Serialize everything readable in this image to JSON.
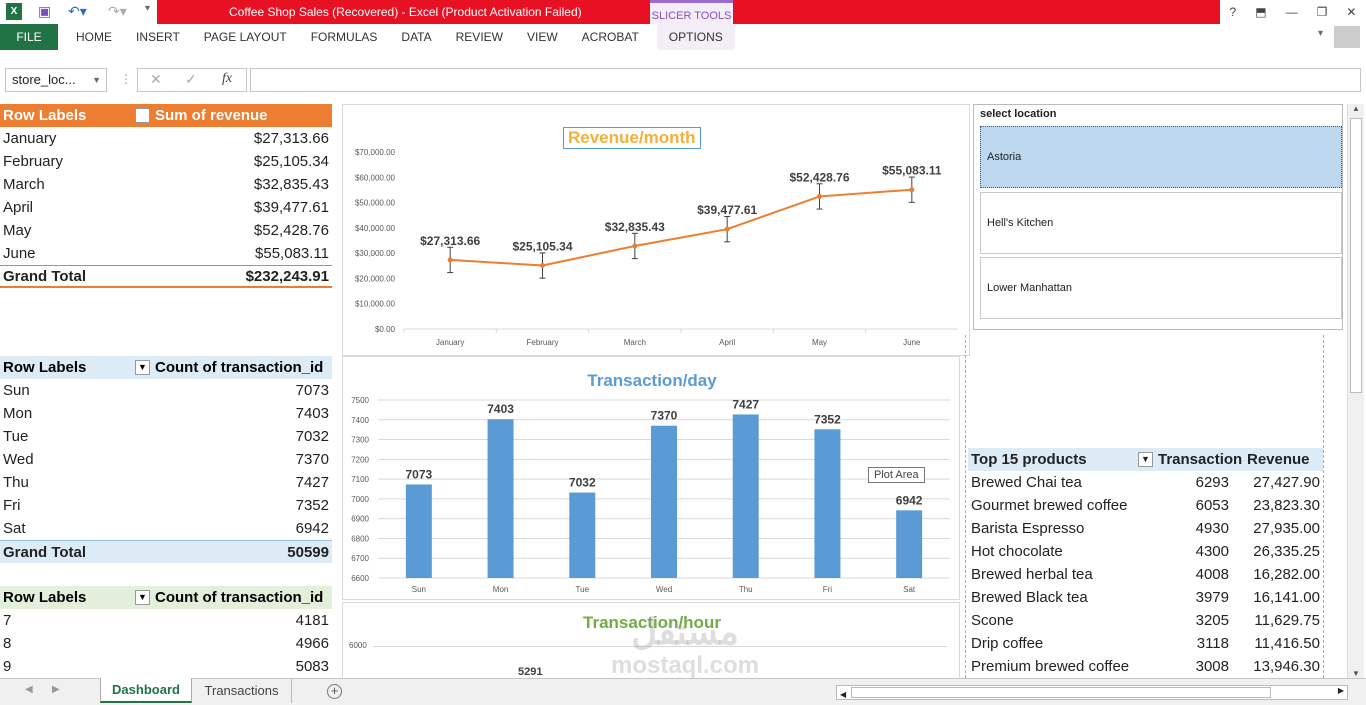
{
  "window": {
    "title": "Coffee Shop Sales (Recovered) -  Excel (Product Activation Failed)",
    "context_tab": "SLICER TOOLS",
    "help": "?"
  },
  "ribbon": {
    "tabs": [
      "FILE",
      "HOME",
      "INSERT",
      "PAGE LAYOUT",
      "FORMULAS",
      "DATA",
      "REVIEW",
      "VIEW",
      "ACROBAT",
      "OPTIONS"
    ]
  },
  "formula_bar": {
    "name_box": "store_loc...",
    "fx": "fx",
    "value": ""
  },
  "revenue_table": {
    "headers": [
      "Row Labels",
      "Sum of revenue"
    ],
    "rows": [
      [
        "January",
        "$27,313.66"
      ],
      [
        "February",
        "$25,105.34"
      ],
      [
        "March",
        "$32,835.43"
      ],
      [
        "April",
        "$39,477.61"
      ],
      [
        "May",
        "$52,428.76"
      ],
      [
        "June",
        "$55,083.11"
      ]
    ],
    "total": [
      "Grand Total",
      "$232,243.91"
    ]
  },
  "day_table": {
    "headers": [
      "Row Labels",
      "Count of transaction_id"
    ],
    "rows": [
      [
        "Sun",
        "7073"
      ],
      [
        "Mon",
        "7403"
      ],
      [
        "Tue",
        "7032"
      ],
      [
        "Wed",
        "7370"
      ],
      [
        "Thu",
        "7427"
      ],
      [
        "Fri",
        "7352"
      ],
      [
        "Sat",
        "6942"
      ]
    ],
    "total": [
      "Grand Total",
      "50599"
    ]
  },
  "hour_table": {
    "headers": [
      "Row Labels",
      "Count of transaction_id"
    ],
    "rows": [
      [
        "7",
        "4181"
      ],
      [
        "8",
        "4966"
      ],
      [
        "9",
        "5083"
      ]
    ]
  },
  "slicer": {
    "title": "select location",
    "items": [
      "Astoria",
      "Hell's Kitchen",
      "Lower Manhattan"
    ],
    "selected": "Astoria"
  },
  "products_table": {
    "headers": [
      "Top 15 products",
      "Transaction",
      "Revenue"
    ],
    "rows": [
      [
        "Brewed Chai tea",
        "6293",
        "27,427.90"
      ],
      [
        "Gourmet brewed coffee",
        "6053",
        "23,823.30"
      ],
      [
        "Barista Espresso",
        "4930",
        "27,935.00"
      ],
      [
        "Hot chocolate",
        "4300",
        "26,335.25"
      ],
      [
        "Brewed herbal tea",
        "4008",
        "16,282.00"
      ],
      [
        "Brewed Black tea",
        "3979",
        "16,141.00"
      ],
      [
        "Scone",
        "3205",
        "11,629.75"
      ],
      [
        "Drip coffee",
        "3118",
        "11,416.50"
      ],
      [
        "Premium brewed coffee",
        "3008",
        "13,946.30"
      ]
    ]
  },
  "tooltip": "Plot Area",
  "sheets": {
    "tabs": [
      "Dashboard",
      "Transactions"
    ],
    "active": "Dashboard"
  },
  "watermark": {
    "arabic": "مستقل",
    "latin": "mostaql.com"
  },
  "chart_data": [
    {
      "type": "line",
      "title": "Revenue/month",
      "categories": [
        "January",
        "February",
        "March",
        "April",
        "May",
        "June"
      ],
      "values": [
        27313.66,
        25105.34,
        32835.43,
        39477.61,
        52428.76,
        55083.11
      ],
      "labels": [
        "$27,313.66",
        "$25,105.34",
        "$32,835.43",
        "$39,477.61",
        "$52,428.76",
        "$55,083.11"
      ],
      "yticks": [
        "$0.00",
        "$10,000.00",
        "$20,000.00",
        "$30,000.00",
        "$40,000.00",
        "$50,000.00",
        "$60,000.00",
        "$70,000.00"
      ],
      "ylim": [
        0,
        70000
      ],
      "error_bars": 5000,
      "color": "#ED7D31",
      "title_color": "#F4B03A"
    },
    {
      "type": "bar",
      "title": "Transaction/day",
      "categories": [
        "Sun",
        "Mon",
        "Tue",
        "Wed",
        "Thu",
        "Fri",
        "Sat"
      ],
      "values": [
        7073,
        7403,
        7032,
        7370,
        7427,
        7352,
        6942
      ],
      "yticks": [
        "6600",
        "6700",
        "6800",
        "6900",
        "7000",
        "7100",
        "7200",
        "7300",
        "7400",
        "7500"
      ],
      "ylim": [
        6600,
        7500
      ],
      "color": "#5B9BD5",
      "title_color": "#5B9BD5"
    },
    {
      "type": "bar",
      "title": "Transaction/hour",
      "yticks": [
        "6000"
      ],
      "visible_labels": [
        "5291"
      ],
      "title_color": "#70AD47"
    }
  ]
}
